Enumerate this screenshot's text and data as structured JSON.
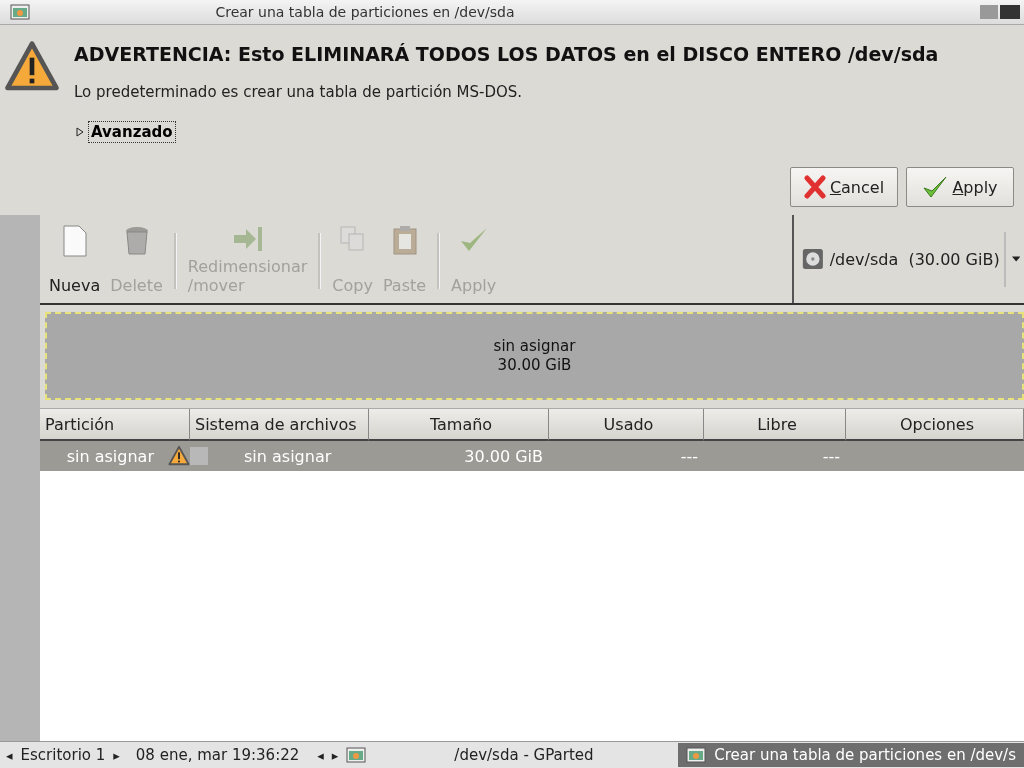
{
  "window": {
    "title": "Crear una tabla de particiones en /dev/sda"
  },
  "dialog": {
    "heading": "ADVERTENCIA: Esto ELIMINARÁ TODOS LOS DATOS en el DISCO ENTERO /dev/sda",
    "message": "Lo predeterminado es crear una tabla de partición MS-DOS.",
    "expander": {
      "label": "Avanzado",
      "expanded": false
    },
    "buttons": [
      {
        "kind": "cancel",
        "label": "Cancel"
      },
      {
        "kind": "apply",
        "label": "Apply"
      }
    ]
  },
  "toolbar": {
    "groups": [
      [
        {
          "kind": "new",
          "label": "Nueva",
          "disabled": false
        },
        {
          "kind": "delete",
          "label": "Delete",
          "disabled": true
        }
      ],
      [
        {
          "kind": "resize",
          "label": "Redimensionar\n/mover",
          "disabled": true
        }
      ],
      [
        {
          "kind": "copy",
          "label": "Copy",
          "disabled": true
        },
        {
          "kind": "paste",
          "label": "Paste",
          "disabled": true
        }
      ],
      [
        {
          "kind": "apply",
          "label": "Apply",
          "disabled": true
        }
      ]
    ],
    "device": "/dev/sda  (30.00 GiB)"
  },
  "disk_map": {
    "lines": [
      "sin asignar",
      "30.00 GiB"
    ]
  },
  "table": {
    "columns": [
      "Partición",
      "Sistema de archivos",
      "Tamaño",
      "Usado",
      "Libre",
      "Opciones"
    ],
    "rows": [
      {
        "selected": true,
        "partition": "sin asignar",
        "warning": true,
        "filesystem": "sin asignar",
        "size": "30.00 GiB",
        "used": "---",
        "free": "---"
      }
    ]
  },
  "taskbar": {
    "desktop": "Escritorio 1",
    "clock": "08 ene, mar 19:36:22",
    "left_arrow": "◂",
    "right_arrow": "▸",
    "center": "/dev/sda - GParted",
    "task": "Crear una tabla de particiones en /dev/s"
  }
}
